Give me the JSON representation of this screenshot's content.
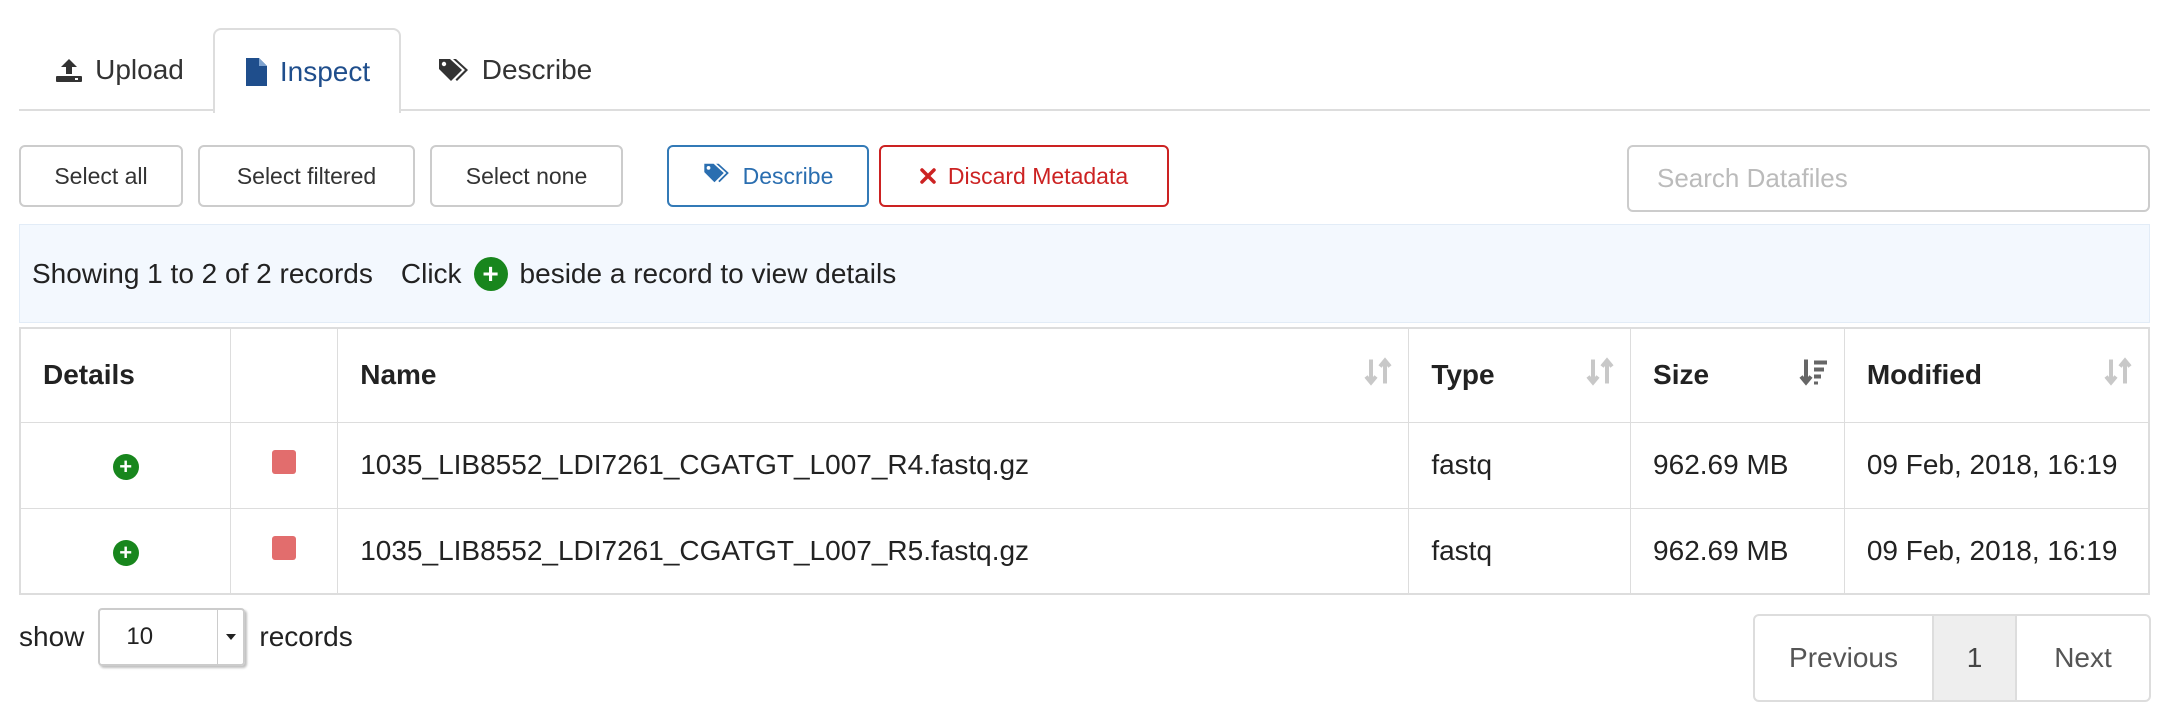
{
  "tabs": [
    {
      "label": "Upload",
      "icon": "upload-icon"
    },
    {
      "label": "Inspect",
      "icon": "file-icon",
      "active": true
    },
    {
      "label": "Describe",
      "icon": "tags-icon"
    }
  ],
  "toolbar": {
    "select_all": "Select all",
    "select_filtered": "Select filtered",
    "select_none": "Select none",
    "describe": "Describe",
    "discard": "Discard Metadata"
  },
  "search": {
    "placeholder": "Search Datafiles"
  },
  "info": {
    "showing": "Showing 1 to 2 of 2 records",
    "click": "Click",
    "rest": "beside a record to view details"
  },
  "table": {
    "headers": {
      "details": "Details",
      "status": "",
      "name": "Name",
      "type": "Type",
      "size": "Size",
      "modified": "Modified"
    },
    "rows": [
      {
        "name": "1035_LIB8552_LDI7261_CGATGT_L007_R4.fastq.gz",
        "type": "fastq",
        "size": "962.69 MB",
        "modified": "09 Feb, 2018, 16:19"
      },
      {
        "name": "1035_LIB8552_LDI7261_CGATGT_L007_R5.fastq.gz",
        "type": "fastq",
        "size": "962.69 MB",
        "modified": "09 Feb, 2018, 16:19"
      }
    ]
  },
  "footer": {
    "show": "show",
    "records_value": "10",
    "records": "records",
    "previous": "Previous",
    "page": "1",
    "next": "Next"
  },
  "colors": {
    "accent": "#337ab7",
    "danger": "#cc2222",
    "details_plus": "#18861d",
    "status_square": "#e26d6d",
    "info_bg": "#f3f8fe"
  }
}
